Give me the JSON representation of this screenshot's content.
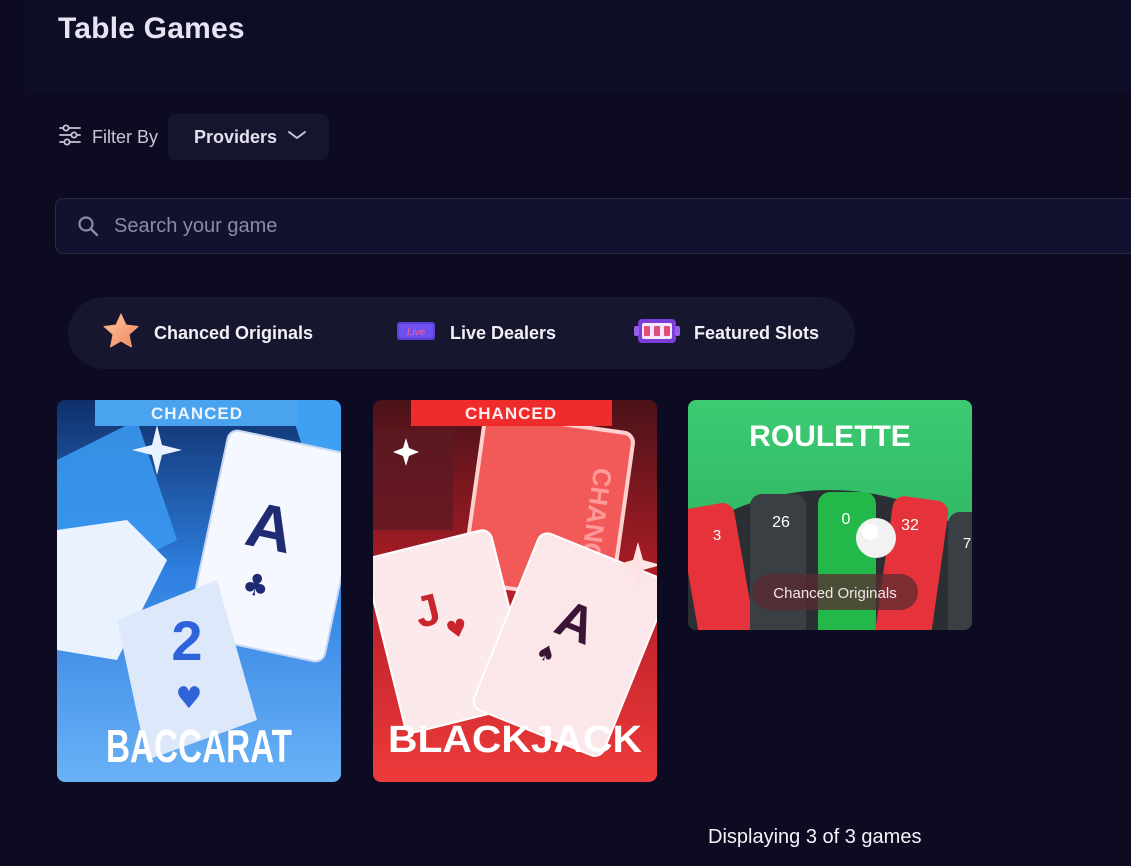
{
  "page": {
    "title": "Table Games"
  },
  "filter": {
    "label": "Filter By",
    "providers_label": "Providers",
    "icon": "sliders-icon",
    "chevron": "chevron-down-icon"
  },
  "search": {
    "placeholder": "Search your game",
    "value": ""
  },
  "categories": [
    {
      "label": "Chanced Originals",
      "icon": "star-icon"
    },
    {
      "label": "Live Dealers",
      "icon": "live-badge-icon",
      "badge": "Live"
    },
    {
      "label": "Featured Slots",
      "icon": "slot-machine-icon"
    }
  ],
  "games": [
    {
      "title": "BACCARAT",
      "brand": "CHANCED",
      "colors": {
        "bg": "#3b8fe6",
        "banner": "#4aa3ee"
      }
    },
    {
      "title": "BLACKJACK",
      "brand": "CHANCED",
      "colors": {
        "bg": "#d8262c",
        "banner": "#ef2b2b"
      }
    },
    {
      "title": "ROULETTE",
      "tag": "Chanced Originals",
      "wheel_numbers": [
        "3",
        "26",
        "0",
        "32",
        "7"
      ],
      "colors": {
        "bg": "#34c66e",
        "pocket_green": "#22b94a",
        "pocket_red": "#e5323b",
        "pocket_dark": "#3a3f44"
      }
    }
  ],
  "footer": {
    "count_text": "Displaying 3 of 3 games"
  }
}
